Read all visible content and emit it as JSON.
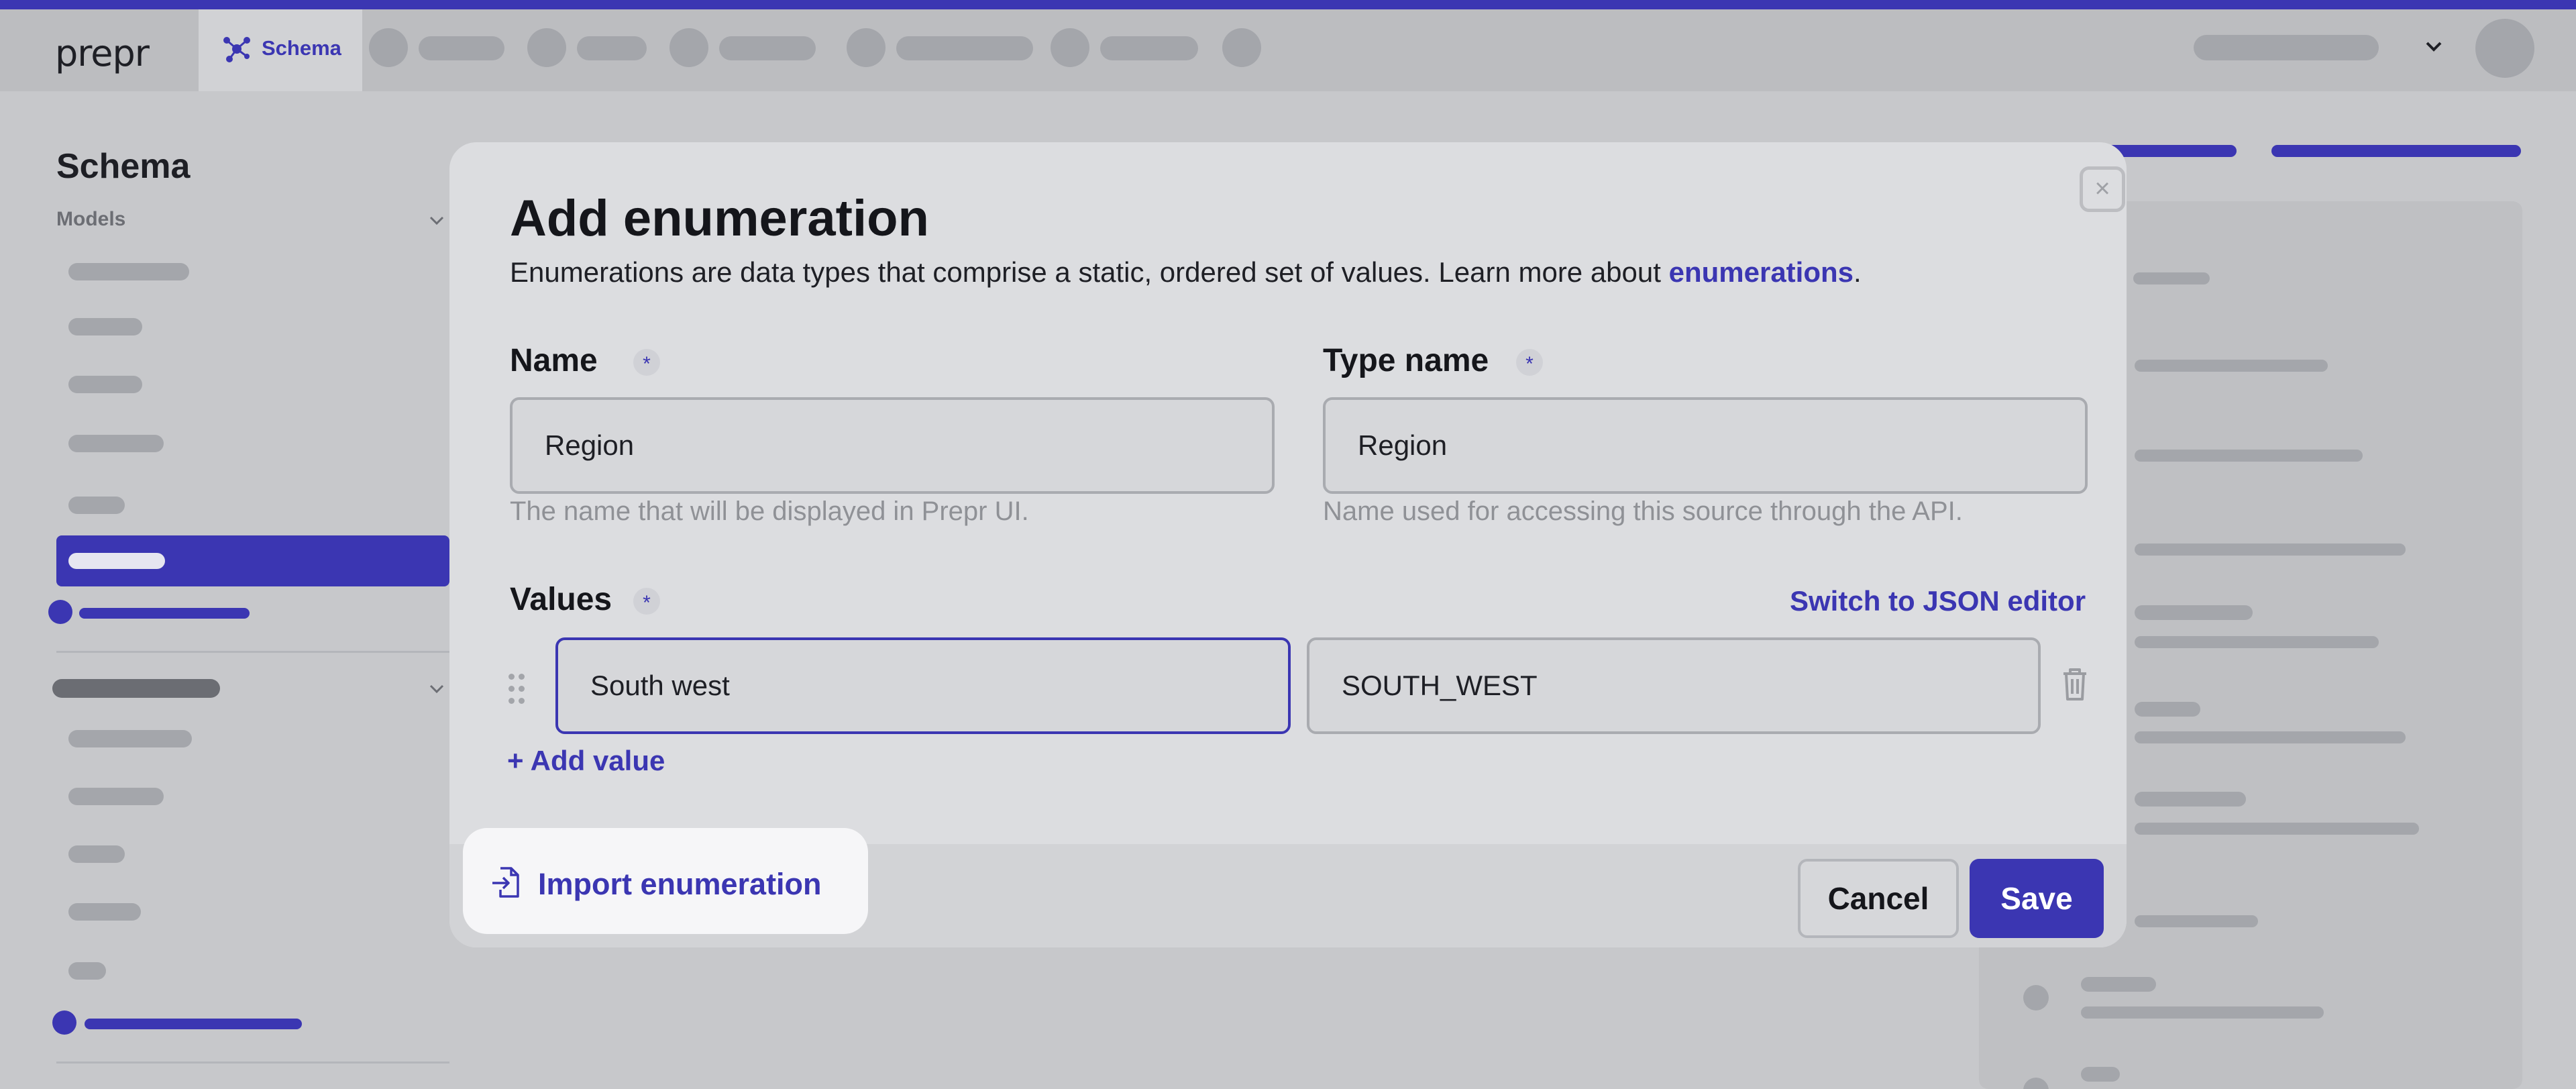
{
  "app": {
    "logo": "prepr",
    "active_tab": "Schema"
  },
  "sidebar": {
    "title": "Schema",
    "section_label": "Models"
  },
  "modal": {
    "title": "Add enumeration",
    "description": "Enumerations are data types that comprise a static, ordered set of values. Learn more about ",
    "description_link": "enumerations",
    "description_end": ".",
    "close_icon": "×",
    "name": {
      "label": "Name",
      "required": "*",
      "value": "Region",
      "hint": "The name that will be displayed in Prepr UI."
    },
    "type_name": {
      "label": "Type name",
      "required": "*",
      "value": "Region",
      "hint": "Name used for accessing this source through the API."
    },
    "values": {
      "label": "Values",
      "required": "*",
      "switch_label": "Switch to JSON editor",
      "items": [
        {
          "label": "South west",
          "key": "SOUTH_WEST"
        }
      ],
      "add_label": "+ Add value"
    },
    "import_label": "Import enumeration",
    "cancel_label": "Cancel",
    "save_label": "Save"
  },
  "colors": {
    "accent": "#3b36b2",
    "backdrop": "#c7c8cb",
    "modal_bg": "#dcdde0"
  }
}
